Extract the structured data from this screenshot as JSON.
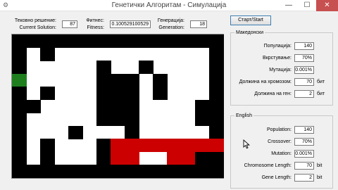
{
  "window": {
    "title": "Генетички Алгоритам - Симулација",
    "min": "—",
    "max": "☐",
    "close": "✕"
  },
  "top": {
    "solution": {
      "label_mk": "Тековно решение:",
      "label_en": "Current Solution:",
      "value": "87"
    },
    "fitness": {
      "label_mk": "Фитнес:",
      "label_en": "Fitness:",
      "value": "0.100529100529"
    },
    "generation": {
      "label_mk": "Генерација:",
      "label_en": "Generation:",
      "value": "18"
    }
  },
  "start_button": {
    "label": "Старт/Start"
  },
  "mk_group": {
    "title": "Македонски",
    "fields": [
      {
        "label": "Популација:",
        "value": "140",
        "unit": ""
      },
      {
        "label": "Вкрстување:",
        "value": "70%",
        "unit": ""
      },
      {
        "label": "Мутација:",
        "value": "0.001%",
        "unit": ""
      },
      {
        "label": "Должина на хромозом:",
        "value": "70",
        "unit": "бит"
      },
      {
        "label": "Должина на ген:",
        "value": "2",
        "unit": "бит"
      }
    ]
  },
  "en_group": {
    "title": "English",
    "fields": [
      {
        "label": "Population:",
        "value": "140",
        "unit": ""
      },
      {
        "label": "Crossover:",
        "value": "70%",
        "unit": ""
      },
      {
        "label": "Mutation:",
        "value": "0.001%",
        "unit": ""
      },
      {
        "label": "Chromosome Length:",
        "value": "70",
        "unit": "bit"
      },
      {
        "label": "Gene Length:",
        "value": "2",
        "unit": "bit"
      }
    ]
  },
  "maze": {
    "cols": 15,
    "rows": 10,
    "legend": {
      "wall": "#000000",
      "start": "#1f7f1f",
      "path": "#cc0000",
      "open": "#ffffff"
    },
    "grid": [
      "WWWWWWWWWWWWWWW",
      "W.W...........W",
      "W.....W..W....W",
      "S.....WWW.W...W",
      "W.W...WWW.W...W",
      "WW....WWW....WW",
      "W.....WWW....WW",
      "W...W...W.....W",
      "W.W...WRRRRRRRR",
      "W.W...WRR..RRWW",
      "WWWWWWWWWWWWWWW"
    ]
  }
}
